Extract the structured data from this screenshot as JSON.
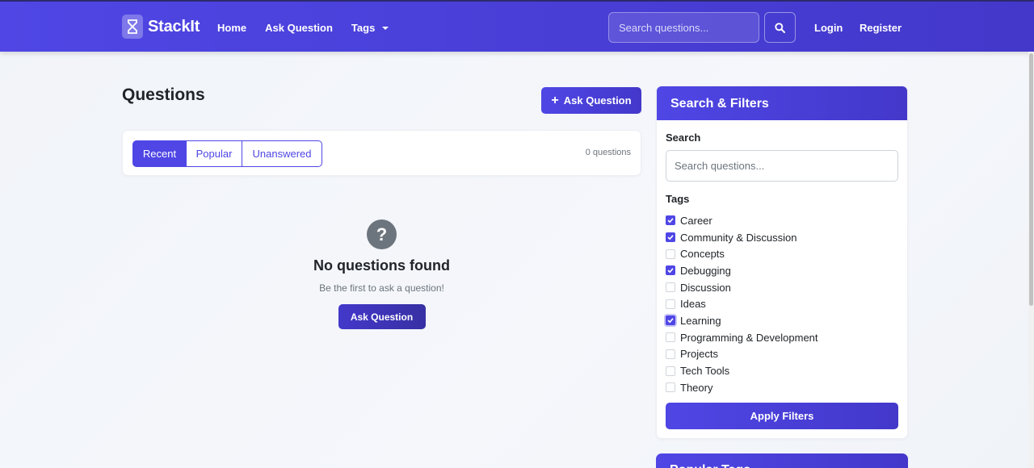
{
  "navbar": {
    "brand": "StackIt",
    "links": [
      "Home",
      "Ask Question",
      "Tags"
    ],
    "search_placeholder": "Search questions...",
    "login": "Login",
    "register": "Register"
  },
  "main": {
    "title": "Questions",
    "ask_button": "Ask Question",
    "tabs": [
      "Recent",
      "Popular",
      "Unanswered"
    ],
    "active_tab": "Recent",
    "count": "0 questions",
    "empty": {
      "icon": "question-circle-icon",
      "title": "No questions found",
      "subtitle": "Be the first to ask a question!",
      "button": "Ask Question"
    }
  },
  "sidebar": {
    "header": "Search & Filters",
    "search_label": "Search",
    "search_placeholder": "Search questions...",
    "tags_label": "Tags",
    "tags": [
      {
        "name": "Career",
        "checked": true
      },
      {
        "name": "Community & Discussion",
        "checked": true
      },
      {
        "name": "Concepts",
        "checked": false
      },
      {
        "name": "Debugging",
        "checked": true
      },
      {
        "name": "Discussion",
        "checked": false
      },
      {
        "name": "Ideas",
        "checked": false
      },
      {
        "name": "Learning",
        "checked": true
      },
      {
        "name": "Programming & Development",
        "checked": false
      },
      {
        "name": "Projects",
        "checked": false
      },
      {
        "name": "Tech Tools",
        "checked": false
      },
      {
        "name": "Theory",
        "checked": false
      }
    ],
    "apply_button": "Apply Filters",
    "popular_tags_header": "Popular Tags"
  },
  "colors": {
    "primary": "#4f46e5",
    "primary_dark": "#4338ca",
    "muted": "#6c757d"
  }
}
